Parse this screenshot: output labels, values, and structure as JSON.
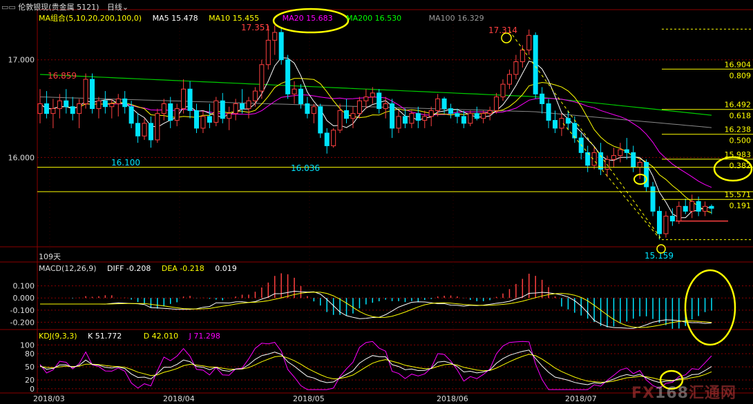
{
  "header": {
    "instrument": "伦敦银现(贵金属 5121)",
    "period": "日线",
    "period_chevron": "⌄"
  },
  "ma_legend": {
    "label": "MA组合(5,10,20,200,100,0)",
    "items": [
      {
        "text": "MA5 15.478",
        "color": "#ffffff"
      },
      {
        "text": "MA10 15.455",
        "color": "#ffff00"
      },
      {
        "text": "MA20 15.683",
        "color": "#ff00ff"
      },
      {
        "text": "MA200 16.530",
        "color": "#00ff00"
      },
      {
        "text": "MA100 16.329",
        "color": "#9a9a9a"
      }
    ]
  },
  "macd_legend": {
    "label": "MACD(12,26,9)",
    "diff": "DIFF -0.208",
    "dea": "DEA -0.218",
    "macd": "0.019"
  },
  "kdj_legend": {
    "label": "KDJ(9,3,3)",
    "k": "K 51.772",
    "d": "D 42.010",
    "j": "J 71.298"
  },
  "day_count": "109天",
  "watermark": {
    "a": "FX",
    "b": "168",
    "c": "汇通网"
  },
  "colors": {
    "up": "#ff4040",
    "down": "#00e5ff",
    "grid": "#8b0000",
    "fib": "#ffff00",
    "annot": "#ffff00"
  },
  "chart_data": [
    {
      "type": "candlestick",
      "title": "伦敦银现 日线",
      "x": [
        "2018/03",
        "2018/04",
        "2018/05",
        "2018/06",
        "2018/07"
      ],
      "ylim": [
        15.1,
        17.4
      ],
      "yticks": [
        "17.000",
        "16.000"
      ],
      "yticks_values": [
        17.0,
        16.0
      ],
      "ohlc": [
        [
          16.45,
          16.7,
          16.35,
          16.55
        ],
        [
          16.55,
          16.68,
          16.4,
          16.45
        ],
        [
          16.45,
          16.6,
          16.3,
          16.5
        ],
        [
          16.5,
          16.65,
          16.4,
          16.58
        ],
        [
          16.58,
          16.7,
          16.45,
          16.52
        ],
        [
          16.52,
          16.62,
          16.38,
          16.45
        ],
        [
          16.45,
          16.6,
          16.3,
          16.55
        ],
        [
          16.55,
          16.86,
          16.5,
          16.8
        ],
        [
          16.8,
          16.86,
          16.45,
          16.5
        ],
        [
          16.5,
          16.62,
          16.4,
          16.58
        ],
        [
          16.58,
          16.68,
          16.45,
          16.52
        ],
        [
          16.52,
          16.6,
          16.4,
          16.55
        ],
        [
          16.55,
          16.65,
          16.42,
          16.6
        ],
        [
          16.6,
          16.68,
          16.45,
          16.52
        ],
        [
          16.52,
          16.58,
          16.3,
          16.35
        ],
        [
          16.35,
          16.45,
          16.15,
          16.22
        ],
        [
          16.22,
          16.4,
          16.18,
          16.35
        ],
        [
          16.35,
          16.42,
          16.1,
          16.18
        ],
        [
          16.18,
          16.5,
          16.15,
          16.45
        ],
        [
          16.45,
          16.6,
          16.38,
          16.55
        ],
        [
          16.55,
          16.62,
          16.3,
          16.38
        ],
        [
          16.38,
          16.55,
          16.32,
          16.5
        ],
        [
          16.5,
          16.8,
          16.45,
          16.7
        ],
        [
          16.7,
          16.78,
          16.4,
          16.48
        ],
        [
          16.48,
          16.55,
          16.25,
          16.3
        ],
        [
          16.3,
          16.48,
          16.25,
          16.42
        ],
        [
          16.42,
          16.55,
          16.3,
          16.36
        ],
        [
          16.36,
          16.62,
          16.32,
          16.58
        ],
        [
          16.58,
          16.66,
          16.35,
          16.4
        ],
        [
          16.4,
          16.52,
          16.28,
          16.45
        ],
        [
          16.45,
          16.6,
          16.38,
          16.55
        ],
        [
          16.55,
          16.7,
          16.45,
          16.5
        ],
        [
          16.5,
          16.62,
          16.4,
          16.58
        ],
        [
          16.58,
          16.72,
          16.52,
          16.68
        ],
        [
          16.68,
          17.0,
          16.6,
          16.95
        ],
        [
          16.95,
          17.35,
          16.9,
          17.2
        ],
        [
          17.2,
          17.35,
          17.05,
          17.28
        ],
        [
          17.28,
          17.32,
          16.95,
          17.0
        ],
        [
          17.0,
          17.05,
          16.6,
          16.65
        ],
        [
          16.65,
          16.78,
          16.55,
          16.7
        ],
        [
          16.7,
          16.75,
          16.5,
          16.55
        ],
        [
          16.55,
          16.62,
          16.4,
          16.45
        ],
        [
          16.45,
          16.55,
          16.35,
          16.52
        ],
        [
          16.52,
          16.55,
          16.2,
          16.25
        ],
        [
          16.25,
          16.3,
          16.04,
          16.12
        ],
        [
          16.12,
          16.3,
          16.1,
          16.28
        ],
        [
          16.28,
          16.55,
          16.25,
          16.48
        ],
        [
          16.48,
          16.6,
          16.35,
          16.4
        ],
        [
          16.4,
          16.52,
          16.3,
          16.45
        ],
        [
          16.45,
          16.62,
          16.4,
          16.58
        ],
        [
          16.58,
          16.7,
          16.5,
          16.62
        ],
        [
          16.62,
          16.72,
          16.55,
          16.66
        ],
        [
          16.66,
          16.7,
          16.45,
          16.5
        ],
        [
          16.5,
          16.62,
          16.4,
          16.55
        ],
        [
          16.55,
          16.6,
          16.2,
          16.3
        ],
        [
          16.3,
          16.48,
          16.25,
          16.42
        ],
        [
          16.42,
          16.5,
          16.3,
          16.35
        ],
        [
          16.35,
          16.48,
          16.3,
          16.45
        ],
        [
          16.45,
          16.52,
          16.3,
          16.38
        ],
        [
          16.38,
          16.48,
          16.3,
          16.42
        ],
        [
          16.42,
          16.52,
          16.32,
          16.48
        ],
        [
          16.48,
          16.65,
          16.42,
          16.6
        ],
        [
          16.6,
          16.62,
          16.45,
          16.5
        ],
        [
          16.5,
          16.55,
          16.4,
          16.45
        ],
        [
          16.45,
          16.5,
          16.35,
          16.42
        ],
        [
          16.42,
          16.48,
          16.3,
          16.35
        ],
        [
          16.35,
          16.48,
          16.32,
          16.45
        ],
        [
          16.45,
          16.52,
          16.38,
          16.4
        ],
        [
          16.4,
          16.48,
          16.35,
          16.45
        ],
        [
          16.45,
          16.52,
          16.38,
          16.48
        ],
        [
          16.48,
          16.66,
          16.45,
          16.62
        ],
        [
          16.62,
          16.8,
          16.58,
          16.75
        ],
        [
          16.75,
          16.9,
          16.7,
          16.85
        ],
        [
          16.85,
          17.05,
          16.8,
          16.98
        ],
        [
          16.98,
          17.15,
          16.92,
          17.1
        ],
        [
          17.1,
          17.31,
          17.05,
          17.25
        ],
        [
          17.25,
          17.28,
          16.6,
          16.65
        ],
        [
          16.65,
          16.72,
          16.45,
          16.55
        ],
        [
          16.55,
          16.6,
          16.3,
          16.38
        ],
        [
          16.38,
          16.48,
          16.25,
          16.3
        ],
        [
          16.3,
          16.45,
          16.22,
          16.4
        ],
        [
          16.4,
          16.48,
          16.28,
          16.35
        ],
        [
          16.35,
          16.42,
          16.15,
          16.2
        ],
        [
          16.2,
          16.25,
          15.98,
          16.05
        ],
        [
          16.05,
          16.12,
          15.85,
          15.92
        ],
        [
          15.92,
          16.1,
          15.88,
          16.05
        ],
        [
          16.05,
          16.15,
          15.82,
          15.88
        ],
        [
          15.88,
          16.02,
          15.8,
          15.98
        ],
        [
          15.98,
          16.1,
          15.9,
          16.02
        ],
        [
          16.02,
          16.15,
          15.95,
          16.08
        ],
        [
          16.08,
          16.2,
          15.98,
          16.05
        ],
        [
          16.05,
          16.12,
          15.85,
          15.9
        ],
        [
          15.9,
          16.0,
          15.78,
          15.95
        ],
        [
          15.95,
          15.98,
          15.65,
          15.7
        ],
        [
          15.7,
          15.75,
          15.4,
          15.45
        ],
        [
          15.45,
          15.5,
          15.16,
          15.22
        ],
        [
          15.22,
          15.45,
          15.18,
          15.4
        ],
        [
          15.4,
          15.48,
          15.3,
          15.35
        ],
        [
          15.35,
          15.55,
          15.32,
          15.5
        ],
        [
          15.5,
          15.58,
          15.42,
          15.45
        ],
        [
          15.45,
          15.62,
          15.38,
          15.55
        ],
        [
          15.55,
          15.6,
          15.4,
          15.45
        ],
        [
          15.45,
          15.55,
          15.4,
          15.5
        ],
        [
          15.5,
          15.52,
          15.42,
          15.48
        ]
      ],
      "annotations": [
        {
          "text": "16.859",
          "color": "#ff4040"
        },
        {
          "text": "16.100",
          "color": "#00e5ff"
        },
        {
          "text": "17.351",
          "color": "#ff4040"
        },
        {
          "text": "16.036",
          "color": "#00e5ff"
        },
        {
          "text": "17.314",
          "color": "#ff4040"
        },
        {
          "text": "15.159",
          "color": "#00e5ff"
        }
      ],
      "fibonacci": [
        {
          "price": "16.904",
          "ratio": "0.809"
        },
        {
          "price": "16.492",
          "ratio": "0.618"
        },
        {
          "price": "16.238",
          "ratio": "0.500"
        },
        {
          "price": "15.983",
          "ratio": "0.382"
        },
        {
          "price": "15.571",
          "ratio": "0.191"
        }
      ],
      "horizontal_lines": [
        15.9,
        15.65
      ]
    },
    {
      "type": "line",
      "title": "MACD(12,26,9)",
      "ylim": [
        -0.26,
        0.2
      ],
      "yticks": [
        "0.100",
        "0.000",
        "-0.100",
        "-0.200"
      ],
      "yticks_values": [
        0.1,
        0.0,
        -0.1,
        -0.2
      ]
    },
    {
      "type": "line",
      "title": "KDJ(9,3,3)",
      "ylim": [
        -5,
        110
      ],
      "yticks": [
        "100",
        "80",
        "50",
        "20",
        "0"
      ],
      "yticks_values": [
        100,
        80,
        50,
        20,
        0
      ]
    }
  ]
}
